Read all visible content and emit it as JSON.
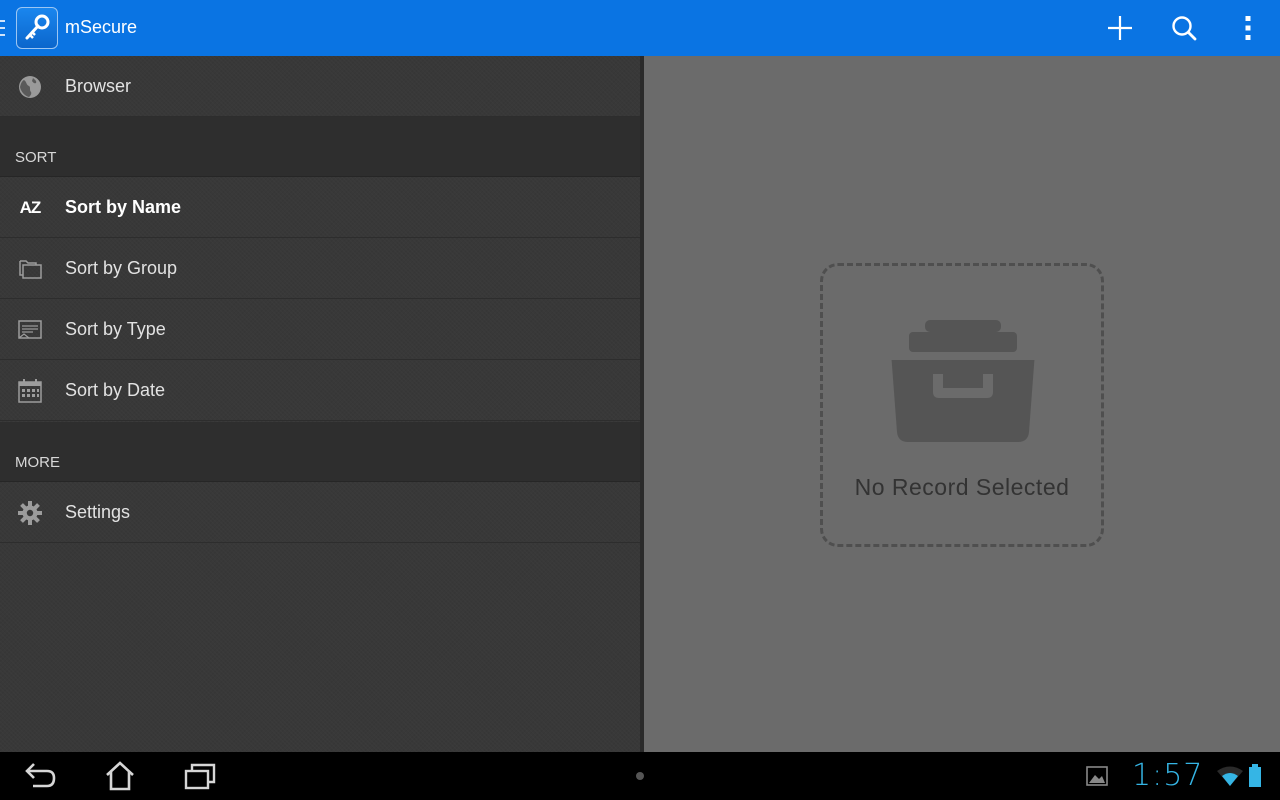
{
  "app": {
    "title": "mSecure",
    "accent_color": "#0a74e3"
  },
  "actionbar": {
    "icons": [
      "add-icon",
      "search-icon",
      "overflow-menu-icon"
    ]
  },
  "drawer": {
    "top_items": [
      {
        "label": "Browser",
        "icon": "globe-icon"
      }
    ],
    "sections": [
      {
        "header": "SORT",
        "items": [
          {
            "label": "Sort by Name",
            "icon": "az-icon",
            "selected": true
          },
          {
            "label": "Sort by Group",
            "icon": "folders-icon",
            "selected": false
          },
          {
            "label": "Sort by Type",
            "icon": "card-icon",
            "selected": false
          },
          {
            "label": "Sort by Date",
            "icon": "calendar-icon",
            "selected": false
          }
        ]
      },
      {
        "header": "MORE",
        "items": [
          {
            "label": "Settings",
            "icon": "gear-icon",
            "selected": false
          }
        ]
      }
    ]
  },
  "detail": {
    "empty_message": "No Record Selected"
  },
  "system_bar": {
    "clock": "1:57",
    "clock_color": "#35b5e5"
  },
  "icons": {
    "az_text": "AZ"
  }
}
